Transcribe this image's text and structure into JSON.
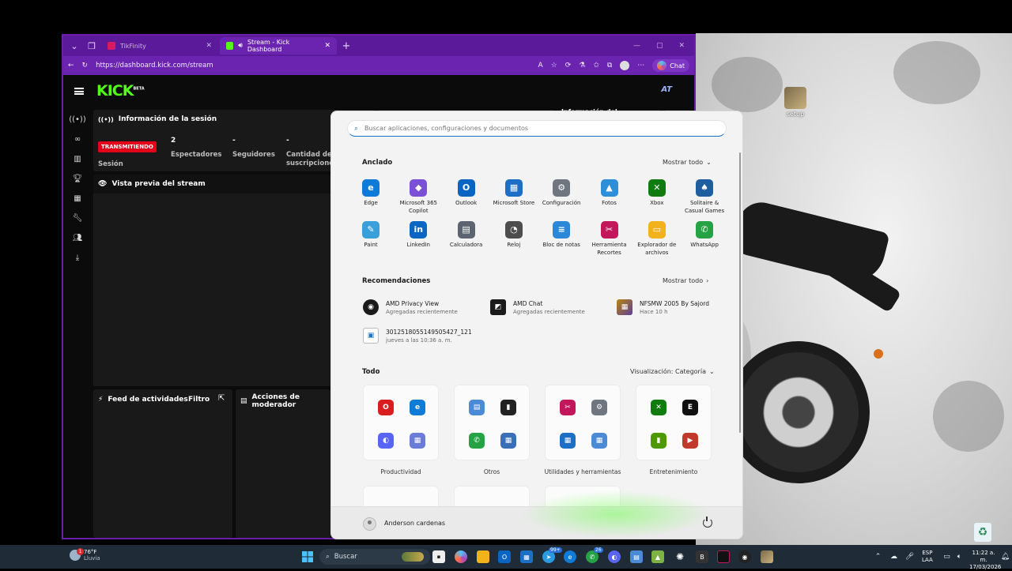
{
  "browser": {
    "tabs": [
      {
        "label": "TikFinity",
        "active": false
      },
      {
        "label": "Stream - Kick Dashboard",
        "active": true
      }
    ],
    "url": "https://dashboard.kick.com/stream",
    "chat_label": "Chat",
    "accent": "#6a24b0"
  },
  "kick": {
    "logo": "KICK",
    "logo_sup": "BETA",
    "sidebar_icons": [
      "broadcast-icon",
      "link-icon",
      "analytics-icon",
      "trophy-icon",
      "video-icon",
      "wrench-icon",
      "users-icon",
      "download-icon"
    ],
    "session_panel": {
      "title": "Información de la sesión",
      "live_badge": "TRANSMITIENDO",
      "session_label": "Sesión",
      "stats": [
        {
          "value": "2",
          "label": "Espectadores"
        },
        {
          "value": "-",
          "label": "Seguidores"
        },
        {
          "value": "-",
          "label": "Cantidad de suscripciones"
        }
      ],
      "info_partial": "Información del"
    },
    "preview_title": "Vista previa del stream",
    "activity": {
      "title": "Feed de actividades",
      "filter": "Filtro"
    },
    "moderator": {
      "title": "Acciones de moderador"
    }
  },
  "start_menu": {
    "search_placeholder": "Buscar aplicaciones, configuraciones y documentos",
    "pinned_title": "Anclado",
    "show_all": "Mostrar todo",
    "pinned": [
      {
        "label": "Edge",
        "color": "#0f7bd8",
        "glyph": "e"
      },
      {
        "label": "Microsoft 365 Copilot",
        "color": "#7b4fd6",
        "glyph": "◆"
      },
      {
        "label": "Outlook",
        "color": "#0a64c2",
        "glyph": "O"
      },
      {
        "label": "Microsoft Store",
        "color": "#1d6fc5",
        "glyph": "▦"
      },
      {
        "label": "Configuración",
        "color": "#6f7680",
        "glyph": "⚙"
      },
      {
        "label": "Fotos",
        "color": "#2d8fd8",
        "glyph": "▲"
      },
      {
        "label": "Xbox",
        "color": "#107c10",
        "glyph": "✕"
      },
      {
        "label": "Solitaire & Casual Games",
        "color": "#1f5f9f",
        "glyph": "♠"
      },
      {
        "label": "Paint",
        "color": "#3aa0d9",
        "glyph": "✎"
      },
      {
        "label": "LinkedIn",
        "color": "#0a66c2",
        "glyph": "in"
      },
      {
        "label": "Calculadora",
        "color": "#5b6470",
        "glyph": "▤"
      },
      {
        "label": "Reloj",
        "color": "#4d4d4d",
        "glyph": "◔"
      },
      {
        "label": "Bloc de notas",
        "color": "#2b88d8",
        "glyph": "≡"
      },
      {
        "label": "Herramienta Recortes",
        "color": "#c2185b",
        "glyph": "✂"
      },
      {
        "label": "Explorador de archivos",
        "color": "#f2b21c",
        "glyph": "▭"
      },
      {
        "label": "WhatsApp",
        "color": "#25a244",
        "glyph": "✆"
      }
    ],
    "rec_title": "Recomendaciones",
    "recommendations": [
      {
        "title": "AMD Privacy View",
        "sub": "Agregadas recientemente",
        "color": "#1a1a1a",
        "glyph": "◉"
      },
      {
        "title": "AMD Chat",
        "sub": "Agregadas recientemente",
        "color": "#1a1a1a",
        "glyph": "◩"
      },
      {
        "title": "NFSMW 2005 By Sajord",
        "sub": "Hace 10 h",
        "color": "#8a6b1a",
        "glyph": "▦"
      },
      {
        "title": "3012518055149505427_121",
        "sub": "jueves a las 10:36 a. m.",
        "color": "#ffffff",
        "glyph": "▣"
      }
    ],
    "all_title": "Todo",
    "view_label": "Visualización: Categoría",
    "categories": [
      {
        "label": "Productividad",
        "icons": [
          [
            "#d81e1e",
            "O"
          ],
          [
            "#0f7bd8",
            "e"
          ],
          [
            "#5865f2",
            "◐"
          ],
          [
            "#6a7bd8",
            "▦"
          ]
        ]
      },
      {
        "label": "Otros",
        "icons": [
          [
            "#4b8bd6",
            "▤"
          ],
          [
            "#222222",
            "▮"
          ],
          [
            "#25a244",
            "✆"
          ],
          [
            "#3a6fb8",
            "▦"
          ]
        ]
      },
      {
        "label": "Utilidades y herramientas",
        "icons": [
          [
            "#c2185b",
            "✂"
          ],
          [
            "#6f7680",
            "⚙"
          ],
          [
            "#1d6fc5",
            "▦"
          ],
          [
            "#4b8bd6",
            "▦"
          ]
        ]
      },
      {
        "label": "Entretenimiento",
        "icons": [
          [
            "#107c10",
            "✕"
          ],
          [
            "#111111",
            "E"
          ],
          [
            "#4c9a00",
            "▮"
          ],
          [
            "#c0392b",
            "▶"
          ]
        ]
      }
    ],
    "user": "Anderson cardenas"
  },
  "desktop": {
    "icon_label": "setup"
  },
  "taskbar": {
    "weather_temp": "76°F",
    "weather_desc": "Lluvia",
    "weather_badge": "1",
    "search": "Buscar",
    "lang": "ESP",
    "lang_sub": "LAA",
    "time": "11:22 a. m.",
    "date": "17/03/2026"
  }
}
